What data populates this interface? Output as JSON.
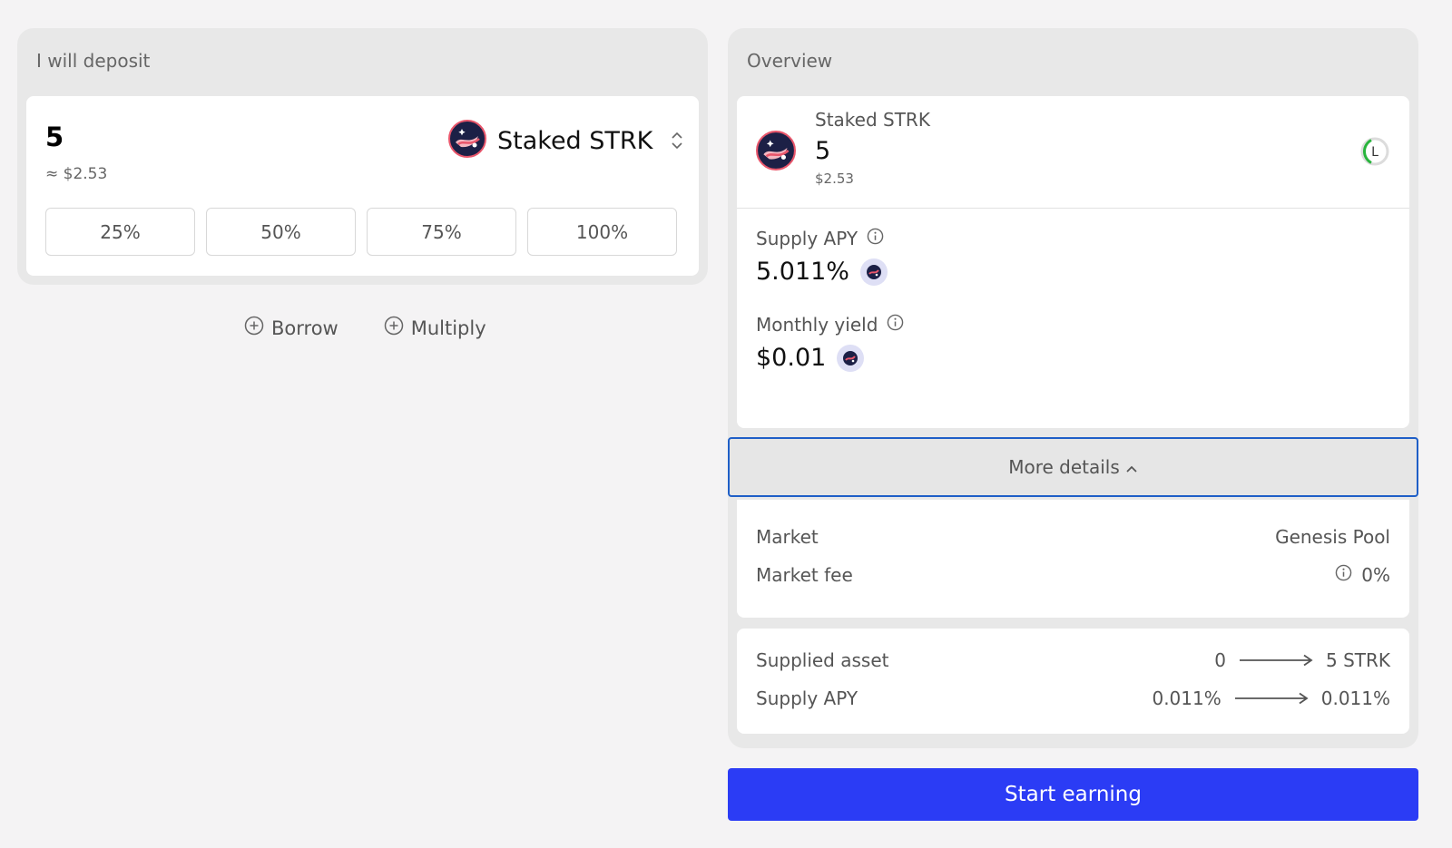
{
  "deposit": {
    "title": "I will deposit",
    "amount": "5",
    "usd_value": "≈ $2.53",
    "token": {
      "name": "Staked STRK",
      "icon": "staked-strk-icon"
    },
    "percent_buttons": [
      "25%",
      "50%",
      "75%",
      "100%"
    ]
  },
  "actions": {
    "borrow_label": "Borrow",
    "multiply_label": "Multiply"
  },
  "overview": {
    "title": "Overview",
    "token_name": "Staked STRK",
    "amount": "5",
    "usd_value": "$2.53",
    "status_letter": "L",
    "supply_apy_label": "Supply APY",
    "supply_apy_value": "5.011%",
    "monthly_yield_label": "Monthly yield",
    "monthly_yield_value": "$0.01",
    "more_details_label": "More details"
  },
  "details": {
    "market_label": "Market",
    "market_value": "Genesis Pool",
    "market_fee_label": "Market fee",
    "market_fee_value": "0%"
  },
  "summary": {
    "supplied_asset_label": "Supplied asset",
    "supplied_from": "0",
    "supplied_to": "5 STRK",
    "supply_apy_label": "Supply APY",
    "apy_from": "0.011%",
    "apy_to": "0.011%"
  },
  "cta": {
    "label": "Start earning"
  },
  "colors": {
    "primary": "#2b3cf5",
    "focus_border": "#1f5fc7",
    "status_green": "#28b43c",
    "token_dark": "#1c2046",
    "token_accent": "#e8566b"
  }
}
